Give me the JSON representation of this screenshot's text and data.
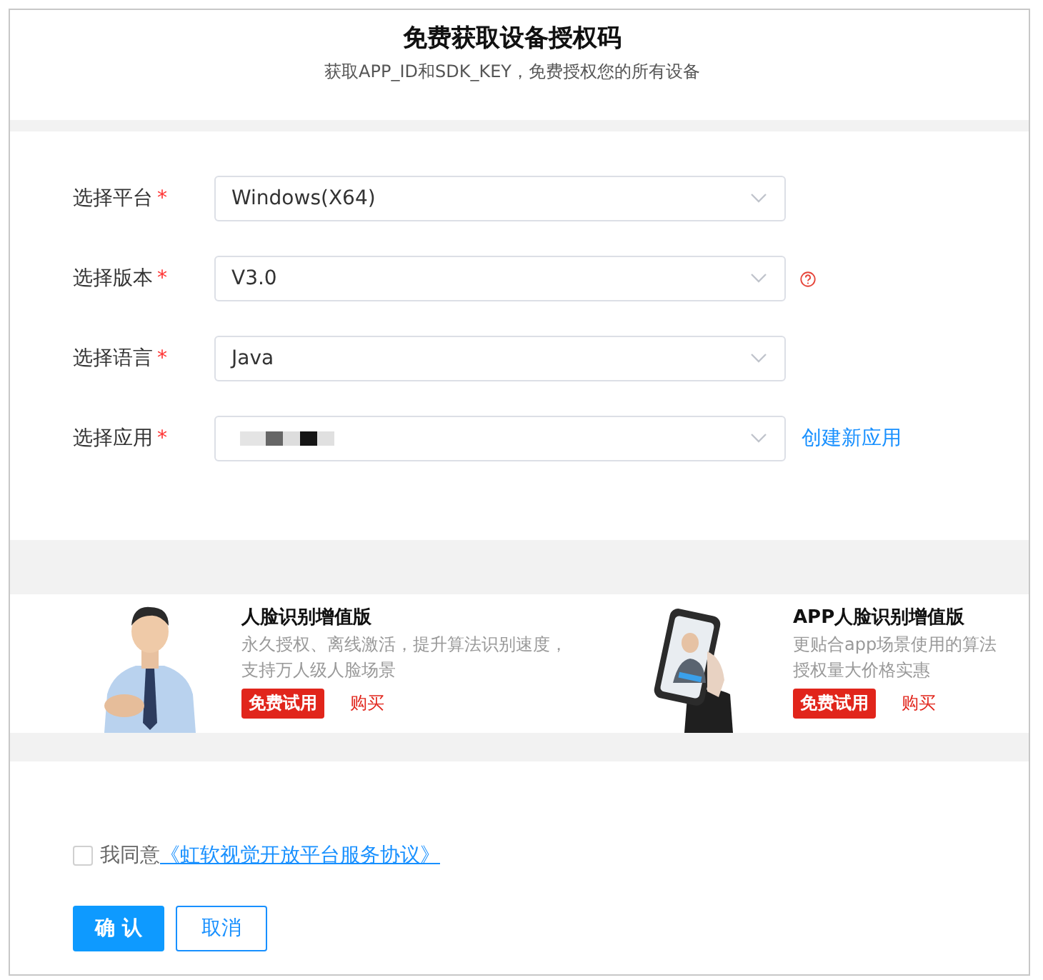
{
  "header": {
    "title": "免费获取设备授权码",
    "subtitle": "获取APP_ID和SDK_KEY，免费授权您的所有设备"
  },
  "form": {
    "fields": [
      {
        "label": "选择平台",
        "required_mark": "*",
        "value": "Windows(X64)",
        "help": false,
        "kind": "select"
      },
      {
        "label": "选择版本",
        "required_mark": "*",
        "value": "V3.0",
        "help": true,
        "kind": "select"
      },
      {
        "label": "选择语言",
        "required_mark": "*",
        "value": "Java",
        "help": false,
        "kind": "select"
      },
      {
        "label": "选择应用",
        "required_mark": "*",
        "kind": "redacted",
        "help": false,
        "link": "创建新应用"
      }
    ]
  },
  "promos": [
    {
      "kind": "person",
      "title": "人脸识别增值版",
      "description": [
        "永久授权、离线激活，提升算法识别速度，",
        "支持万人级人脸场景"
      ],
      "trial": "免费试用",
      "buy": "购买"
    },
    {
      "kind": "phone",
      "title": "APP人脸识别增值版",
      "description": [
        "更贴合app场景使用的算法",
        "授权量大价格实惠"
      ],
      "trial": "免费试用",
      "buy": "购买"
    }
  ],
  "agreement": {
    "checked": false,
    "text": "我同意",
    "link": "《虹软视觉开放平台服务协议》"
  },
  "buttons": {
    "confirm": "确 认",
    "cancel": "取消"
  }
}
